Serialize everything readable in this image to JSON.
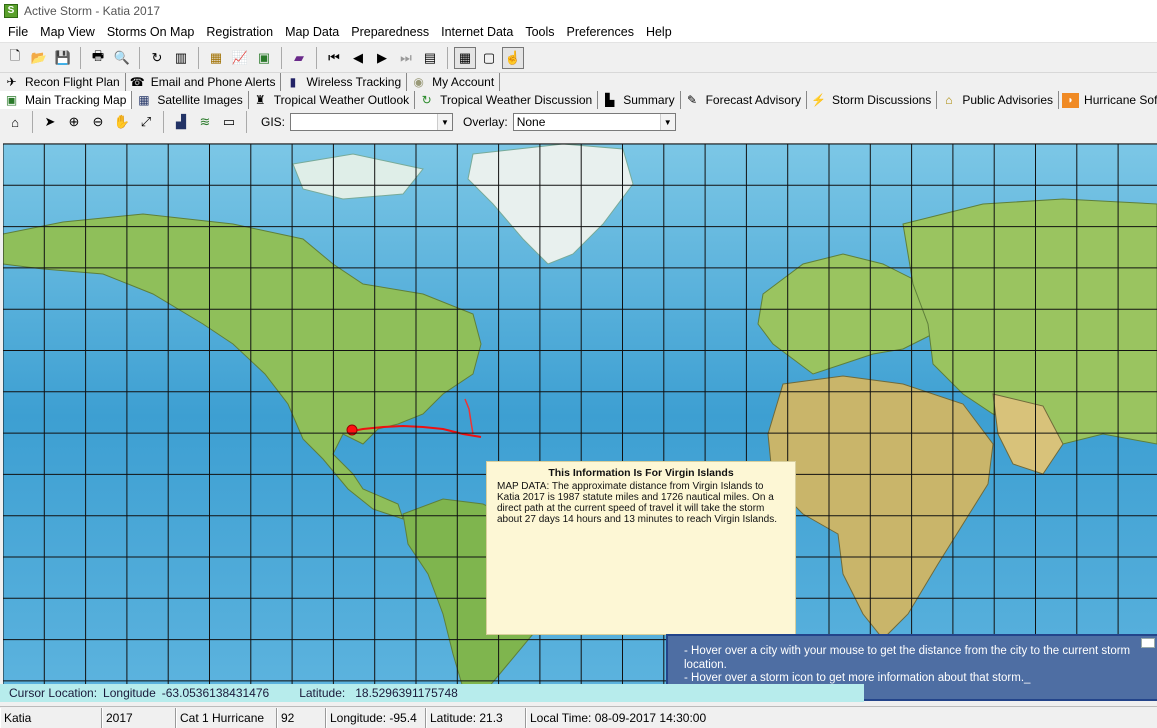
{
  "window": {
    "title": "Active Storm - Katia 2017"
  },
  "menu": [
    "File",
    "Map View",
    "Storms On Map",
    "Registration",
    "Map Data",
    "Preparedness",
    "Internet Data",
    "Tools",
    "Preferences",
    "Help"
  ],
  "tabs_row1": [
    {
      "label": "Recon Flight Plan",
      "icon": "plane-icon"
    },
    {
      "label": "Email and Phone Alerts",
      "icon": "alert-icon"
    },
    {
      "label": "Wireless Tracking",
      "icon": "wireless-icon"
    },
    {
      "label": "My Account",
      "icon": "account-icon"
    }
  ],
  "tabs_row2": [
    {
      "label": "Main Tracking Map",
      "icon": "map-icon"
    },
    {
      "label": "Satellite Images",
      "icon": "satellite-icon"
    },
    {
      "label": "Tropical Weather Outlook",
      "icon": "binoculars-icon"
    },
    {
      "label": "Tropical Weather Discussion",
      "icon": "refresh-icon"
    },
    {
      "label": "Summary",
      "icon": "chart-icon"
    },
    {
      "label": "Forecast Advisory",
      "icon": "pen-icon"
    },
    {
      "label": "Storm Discussions",
      "icon": "lightning-icon"
    },
    {
      "label": "Public Advisories",
      "icon": "house-icon"
    },
    {
      "label": "Hurricane Software New",
      "icon": "rss-icon"
    }
  ],
  "map_toolbar": {
    "gis_label": "GIS:",
    "gis_value": "",
    "overlay_label": "Overlay:",
    "overlay_value": "None"
  },
  "info_popup": {
    "title": "This Information Is For Virgin Islands",
    "body": "MAP DATA: The approximate distance from Virgin Islands to Katia 2017 is 1987 statute miles and 1726 nautical miles.  On a direct path at the current speed of travel it will take the storm about 27 days 14 hours and 13 minutes to reach Virgin Islands."
  },
  "help_panel": {
    "line1": "- Hover over a city with your mouse to get the distance from the city to the current storm location.",
    "line2": "- Hover over a storm icon to get more information about that storm._"
  },
  "cursor": {
    "label": "Cursor Location:",
    "lon_label": "Longitude",
    "lon_value": "-63.0536138431476",
    "lat_label": "Latitude:",
    "lat_value": "18.5296391175748"
  },
  "status": {
    "storm": "Katia",
    "year": "2017",
    "category": "Cat 1 Hurricane",
    "wind": "92",
    "longitude": "Longitude: -95.4",
    "latitude": "Latitude: 21.3",
    "local_time": "Local Time: 08-09-2017 14:30:00"
  },
  "colors": {
    "ocean": "#4aa6d4",
    "land": "#8fbf5a",
    "popup": "#fdf7d5",
    "help_panel": "#4e6ea3",
    "cursor_bar": "#b7ecec"
  }
}
